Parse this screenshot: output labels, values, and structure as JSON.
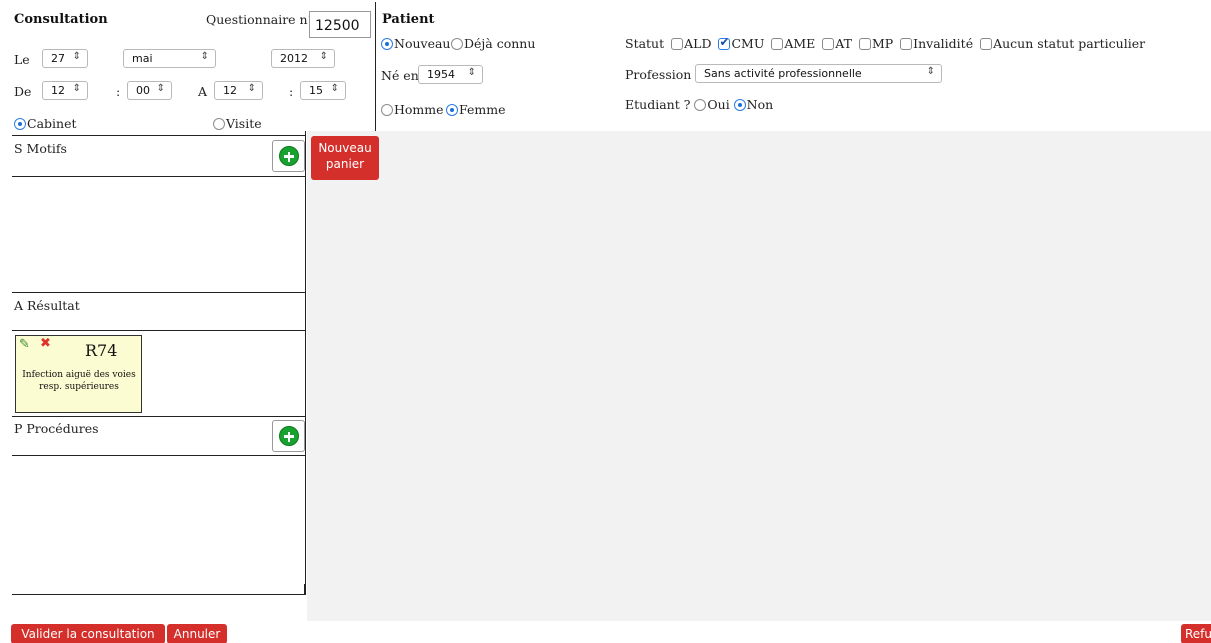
{
  "consultation": {
    "title": "Consultation",
    "questionnaire_label": "Questionnaire n°",
    "questionnaire_value": "12500",
    "date_label": "Le",
    "day": "27",
    "month": "mai",
    "year": "2012",
    "from_label": "De",
    "from_hour": "12",
    "from_min": "00",
    "to_label": "A",
    "to_hour": "12",
    "to_min": "15",
    "colon": ":",
    "place_options": [
      "Cabinet",
      "Visite"
    ],
    "place_selected": "Cabinet"
  },
  "patient": {
    "title": "Patient",
    "type_options": [
      "Nouveau",
      "Déjà connu"
    ],
    "type_selected": "Nouveau",
    "born_label": "Né en",
    "born_year": "1954",
    "sex_options": [
      "Homme",
      "Femme"
    ],
    "sex_selected": "Femme",
    "statut_label": "Statut",
    "statut_options": [
      "ALD",
      "CMU",
      "AME",
      "AT",
      "MP",
      "Invalidité",
      "Aucun statut particulier"
    ],
    "statut_checked": [
      "CMU"
    ],
    "profession_label": "Profession",
    "profession_value": "Sans activité professionnelle",
    "student_label": "Etudiant ?",
    "student_options": [
      "Oui",
      "Non"
    ],
    "student_selected": "Non"
  },
  "sections": {
    "motifs": "S Motifs",
    "resultat": "A Résultat",
    "procedures": "P Procédures"
  },
  "result_card": {
    "code": "R74",
    "description": "Infection aiguë des voies resp. supérieures"
  },
  "buttons": {
    "new_basket": "Nouveau panier",
    "validate": "Valider la consultation",
    "cancel": "Annuler",
    "refuse": "Refu"
  },
  "colors": {
    "button_red": "#d42f2a",
    "plus_green": "#19a22f",
    "card_yellow": "#fcfcd2",
    "radio_blue": "#1b6fd8",
    "panel_grey": "#f2f2f2"
  }
}
